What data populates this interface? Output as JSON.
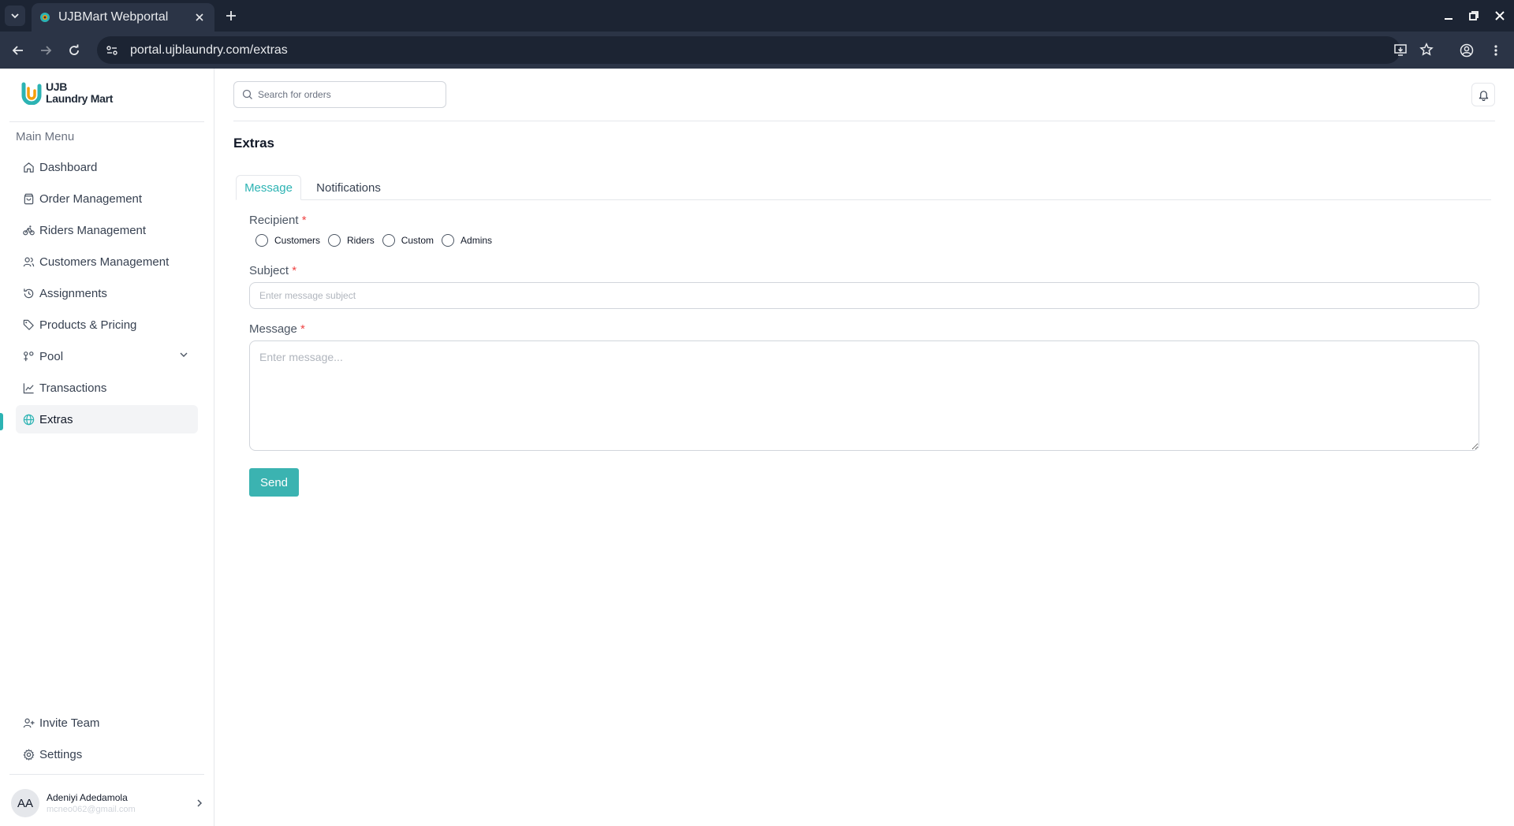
{
  "browser": {
    "tab_title": "UJBMart Webportal",
    "url": "portal.ujblaundry.com/extras"
  },
  "brand": {
    "line1": "UJB",
    "line2": "Laundry Mart",
    "accent": "#2cb3b3"
  },
  "sidebar": {
    "menu_title": "Main Menu",
    "items": [
      {
        "label": "Dashboard",
        "icon": "home-icon"
      },
      {
        "label": "Order Management",
        "icon": "shopping-bag-icon"
      },
      {
        "label": "Riders Management",
        "icon": "bike-icon"
      },
      {
        "label": "Customers Management",
        "icon": "users-icon"
      },
      {
        "label": "Assignments",
        "icon": "history-icon"
      },
      {
        "label": "Products & Pricing",
        "icon": "tags-icon"
      },
      {
        "label": "Pool",
        "icon": "pool-icon"
      },
      {
        "label": "Transactions",
        "icon": "line-chart-icon"
      },
      {
        "label": "Extras",
        "icon": "globe-icon",
        "active": true
      }
    ],
    "bottom": [
      {
        "label": "Invite Team",
        "icon": "user-plus-icon"
      },
      {
        "label": "Settings",
        "icon": "gear-icon"
      }
    ],
    "user": {
      "initials": "AA",
      "name": "Adeniyi Adedamola",
      "email": "mcneo062@gmail.com"
    }
  },
  "header": {
    "search_placeholder": "Search for orders"
  },
  "page": {
    "title": "Extras",
    "tabs": [
      {
        "label": "Message",
        "active": true
      },
      {
        "label": "Notifications",
        "active": false
      }
    ],
    "form": {
      "recipient_label": "Recipient",
      "required_mark": "*",
      "recipient_options": [
        "Customers",
        "Riders",
        "Custom",
        "Admins"
      ],
      "subject_label": "Subject",
      "subject_placeholder": "Enter message subject",
      "message_label": "Message",
      "message_placeholder": "Enter message...",
      "send_label": "Send"
    }
  }
}
